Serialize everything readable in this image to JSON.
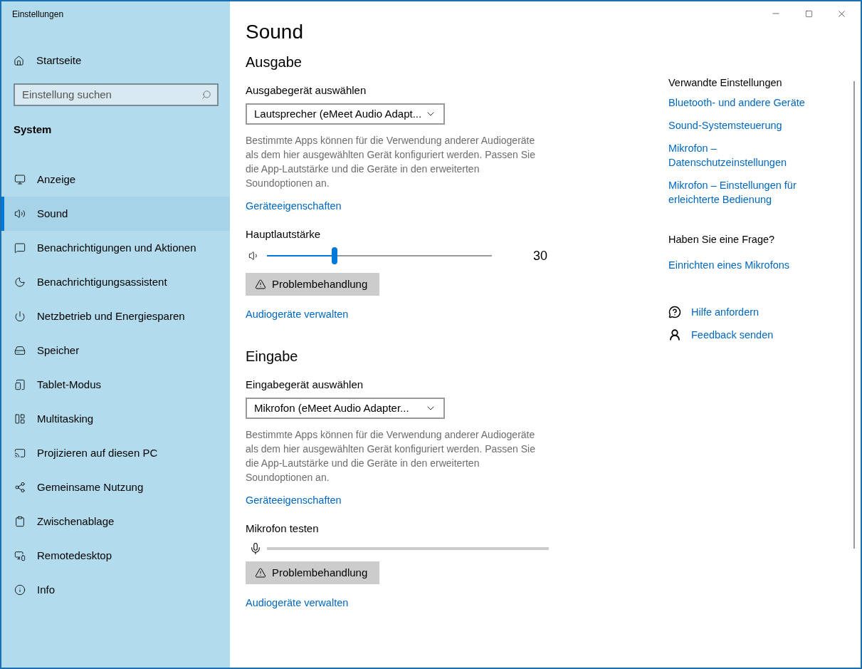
{
  "window": {
    "title": "Einstellungen"
  },
  "sidebar": {
    "home": "Startseite",
    "search": {
      "placeholder": "Einstellung suchen"
    },
    "section": "System",
    "items": [
      {
        "label": "Anzeige",
        "selected": false
      },
      {
        "label": "Sound",
        "selected": true
      },
      {
        "label": "Benachrichtigungen und Aktionen",
        "selected": false
      },
      {
        "label": "Benachrichtigungsassistent",
        "selected": false
      },
      {
        "label": "Netzbetrieb und Energiesparen",
        "selected": false
      },
      {
        "label": "Speicher",
        "selected": false
      },
      {
        "label": "Tablet-Modus",
        "selected": false
      },
      {
        "label": "Multitasking",
        "selected": false
      },
      {
        "label": "Projizieren auf diesen PC",
        "selected": false
      },
      {
        "label": "Gemeinsame Nutzung",
        "selected": false
      },
      {
        "label": "Zwischenablage",
        "selected": false
      },
      {
        "label": "Remotedesktop",
        "selected": false
      },
      {
        "label": "Info",
        "selected": false
      }
    ]
  },
  "page": {
    "title": "Sound",
    "sections": [
      {
        "kind": "output",
        "heading": "Ausgabe",
        "device_label": "Ausgabegerät auswählen",
        "device": "Lautsprecher (eMeet Audio Adapt...",
        "description": "Bestimmte Apps können für die Verwendung anderer Audiogeräte als dem hier ausgewählten Gerät konfiguriert werden. Passen Sie die App-Lautstärke und die Geräte in den erweiterten Soundoptionen an.",
        "properties_link": "Geräteeigenschaften",
        "meter_label": "Hauptlautstärke",
        "level": 0.3,
        "reading": "30",
        "troubleshoot": "Problembehandlung",
        "manage_link": "Audiogeräte verwalten"
      },
      {
        "kind": "input",
        "heading": "Eingabe",
        "device_label": "Eingabegerät auswählen",
        "device": "Mikrofon (eMeet Audio Adapter...",
        "description": "Bestimmte Apps können für die Verwendung anderer Audiogeräte als dem hier ausgewählten Gerät konfiguriert werden. Passen Sie die App-Lautstärke und die Geräte in den erweiterten Soundoptionen an.",
        "properties_link": "Geräteeigenschaften",
        "meter_label": "Mikrofon testen",
        "troubleshoot": "Problembehandlung",
        "manage_link": "Audiogeräte verwalten"
      }
    ]
  },
  "related": {
    "heading": "Verwandte Einstellungen",
    "links": [
      "Bluetooth- und andere Geräte",
      "Sound-Systemsteuerung",
      "Mikrofon – Datenschutzeinstellungen",
      "Mikrofon – Einstellungen für erleichterte Bedienung"
    ]
  },
  "question": {
    "heading": "Haben Sie eine Frage?",
    "link": "Einrichten eines Mikrofons"
  },
  "help_links": [
    {
      "kind": "help",
      "label": "Hilfe anfordern"
    },
    {
      "kind": "feedback",
      "label": "Feedback senden"
    }
  ]
}
